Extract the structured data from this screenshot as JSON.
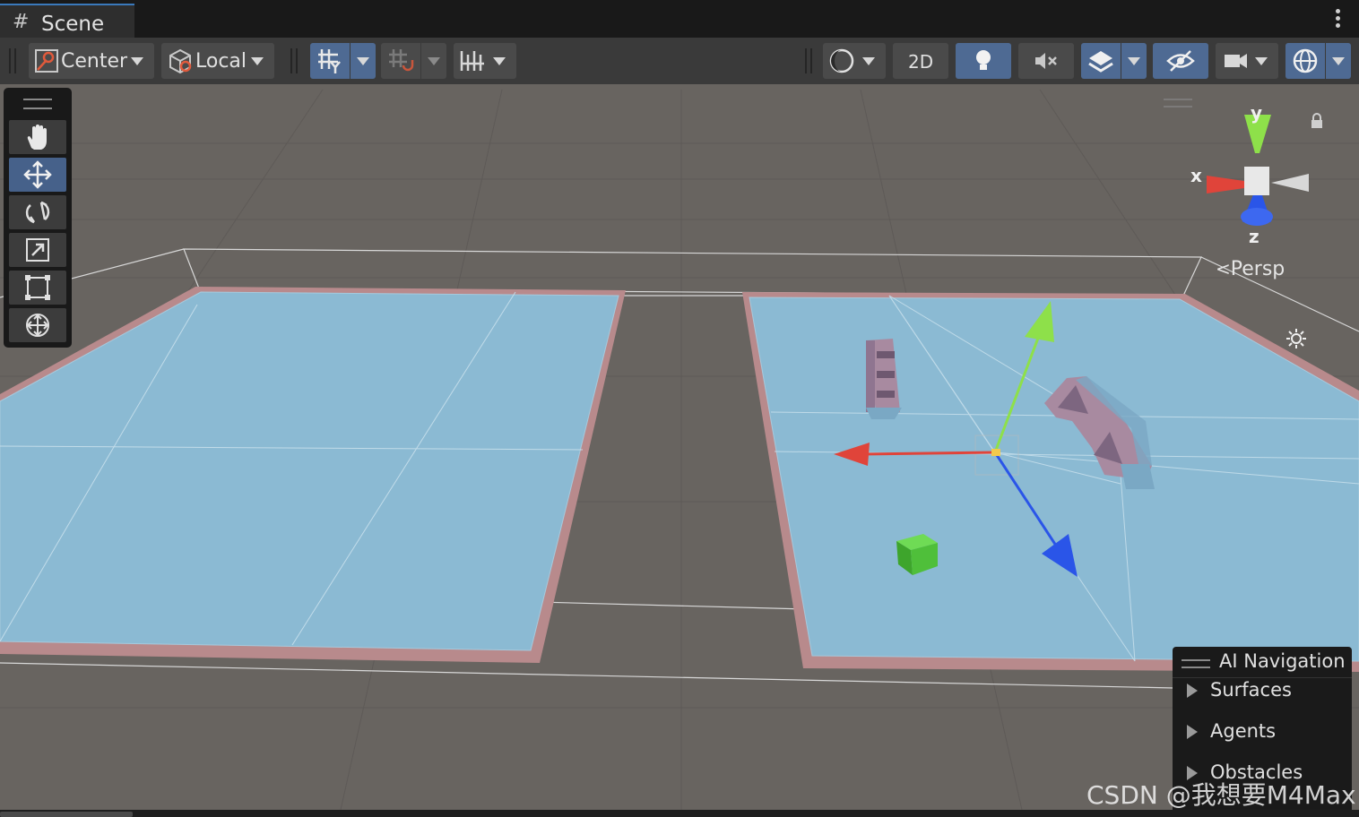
{
  "window": {
    "tab_title": "Scene"
  },
  "toolbar": {
    "pivot_label": "Center",
    "space_label": "Local",
    "mode_2d_label": "2D"
  },
  "icons": {
    "tab": "grid-icon",
    "pivot": "pivot-center-icon",
    "space": "local-space-cube-icon",
    "grid_visibility": "grid-y-icon",
    "grid_snapping": "grid-snap-icon",
    "increment_snapping": "increment-snap-icon",
    "shading": "shading-mode-icon",
    "lighting": "lighting-bulb-icon",
    "audio": "audio-mute-icon",
    "effects": "effects-layers-icon",
    "hidden_objects": "hidden-eye-icon",
    "camera": "scene-camera-icon",
    "gizmos": "gizmos-globe-icon"
  },
  "tools": [
    "hand-tool",
    "move-tool",
    "rotate-tool",
    "scale-tool",
    "rect-tool",
    "transform-tool"
  ],
  "selected_tool": "move-tool",
  "orientation_gizmo": {
    "x_label": "x",
    "y_label": "y",
    "z_label": "z",
    "projection_label": "Persp"
  },
  "overlay_panel": {
    "title": "AI Navigation",
    "items": [
      "Surfaces",
      "Agents",
      "Obstacles"
    ]
  },
  "watermark": "CSDN @我想要M4Max",
  "colors": {
    "active_button": "#4e6a93",
    "navmesh": "#8bbad3",
    "navmesh_border": "#b88a8c",
    "axis_x": "#e0443a",
    "axis_y": "#8ee04a",
    "axis_z": "#2a55e8",
    "cube": "#4fbf3a"
  }
}
